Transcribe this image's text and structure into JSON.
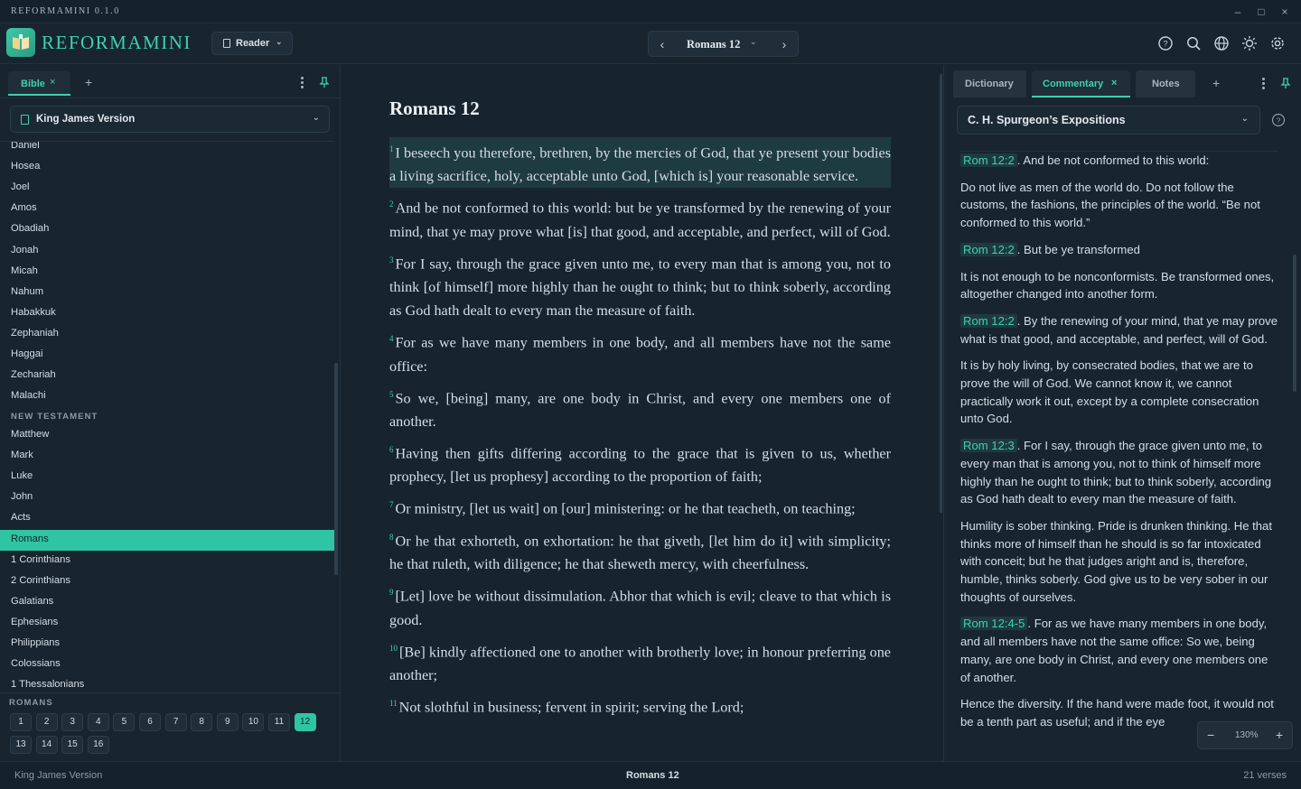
{
  "titlebar": {
    "title": "REFORMAMINI 0.1.0",
    "minimize": "–",
    "maximize": "□",
    "close": "×"
  },
  "header": {
    "logo_text": "REFORMAMINI",
    "mode_label": "Reader",
    "nav_title": "Romans 12",
    "icons": [
      "help-icon",
      "search-icon",
      "globe-icon",
      "sun-icon",
      "gear-icon"
    ]
  },
  "left": {
    "tab_label": "Bible",
    "version": "King James Version",
    "books_ot_tail": [
      "Daniel",
      "Hosea",
      "Joel",
      "Amos",
      "Obadiah",
      "Jonah",
      "Micah",
      "Nahum",
      "Habakkuk",
      "Zephaniah",
      "Haggai",
      "Zechariah",
      "Malachi"
    ],
    "nt_heading": "NEW TESTAMENT",
    "books_nt": [
      "Matthew",
      "Mark",
      "Luke",
      "John",
      "Acts",
      "Romans",
      "1 Corinthians",
      "2 Corinthians",
      "Galatians",
      "Ephesians",
      "Philippians",
      "Colossians",
      "1 Thessalonians"
    ],
    "selected_book": "Romans",
    "chapters_heading": "ROMANS",
    "chapters": [
      "1",
      "2",
      "3",
      "4",
      "5",
      "6",
      "7",
      "8",
      "9",
      "10",
      "11",
      "12",
      "13",
      "14",
      "15",
      "16"
    ],
    "selected_chapter": "12"
  },
  "main": {
    "heading": "Romans 12",
    "verses": [
      {
        "n": "1",
        "text": "I beseech you therefore, brethren, by the mercies of God, that ye present your bodies a living sacrifice, holy, acceptable unto God, [which is] your reasonable service."
      },
      {
        "n": "2",
        "text": "And be not conformed to this world: but be ye transformed by the renewing of your mind, that ye may prove what [is] that good, and acceptable, and perfect, will of God."
      },
      {
        "n": "3",
        "text": "For I say, through the grace given unto me, to every man that is among you, not to think [of himself] more highly than he ought to think; but to think so­berly, according as God hath dealt to every man the measure of faith."
      },
      {
        "n": "4",
        "text": "For as we have many members in one body, and all members have not the same office:"
      },
      {
        "n": "5",
        "text": "So we, [being] many, are one body in Christ, and every one members one of another."
      },
      {
        "n": "6",
        "text": "Having then gifts differing according to the grace that is given to us, whether prophecy, [let us prophesy] according to the proportion of faith;"
      },
      {
        "n": "7",
        "text": "Or ministry, [let us wait] on [our] ministering: or he that teacheth, on teaching;"
      },
      {
        "n": "8",
        "text": "Or he that exhorteth, on exhortation: he that giveth, [let him do it] with sim­plicity; he that ruleth, with diligence; he that sheweth mercy, with cheerfulness."
      },
      {
        "n": "9",
        "text": "[Let] love be without dissimulation. Abhor that which is evil; cleave to that which is good."
      },
      {
        "n": "10",
        "text": "[Be] kindly affectioned one to another with brotherly love; in honour prefe­rring one another;"
      },
      {
        "n": "11",
        "text": "Not slothful in business; fervent in spirit; serving the Lord;"
      }
    ]
  },
  "right": {
    "tabs": [
      "Dictionary",
      "Commentary",
      "Notes"
    ],
    "active_tab": "Commentary",
    "source": "C. H. Spurgeon’s Expositions",
    "entries": [
      {
        "ref": "Rom 12:2",
        "text": ". And be not conformed to this world:"
      },
      {
        "ref": "",
        "text": "Do not live as men of the world do. Do not follow the customs, the fashions, the principles of the world. “Be not conformed to this world.”"
      },
      {
        "ref": "Rom 12:2",
        "text": ". But be ye transformed"
      },
      {
        "ref": "",
        "text": "It is not enough to be nonconformists. Be transformed ones, altogether changed into another form."
      },
      {
        "ref": "Rom 12:2",
        "text": ". By the renewing of your mind, that ye may prove what is that good, and acceptable, and perfect, will of God."
      },
      {
        "ref": "",
        "text": "It is by holy living, by consecrated bodies, that we are to prove the will of God. We cannot know it, we cannot practically work it out, except by a complete consecration unto God."
      },
      {
        "ref": "Rom 12:3",
        "text": ". For I say, through the grace given unto me, to every man that is among you, not to think of himself more highly than he ought to think; but to think soberly, according as God hath dealt to every man the measure of faith."
      },
      {
        "ref": "",
        "text": "Humility is sober thinking. Pride is drunken thinking. He that thinks more of himself than he should is so far intoxicated with conceit; but he that judges aright and is, therefore, humble, thinks soberly. God give us to be very sober in our thoughts of ourselves."
      },
      {
        "ref": "Rom 12:4-5",
        "text": ". For as we have many members in one body, and all members have not the same office: So we, being many, are one body in Christ, and every one members one of another."
      },
      {
        "ref": "",
        "text": "Hence the diversity. If the hand were made foot, it would not be a tenth part as useful; and if the eye"
      }
    ],
    "zoom_value": "130%"
  },
  "status": {
    "left": "King James Version",
    "center": "Romans 12",
    "right": "21 verses"
  }
}
